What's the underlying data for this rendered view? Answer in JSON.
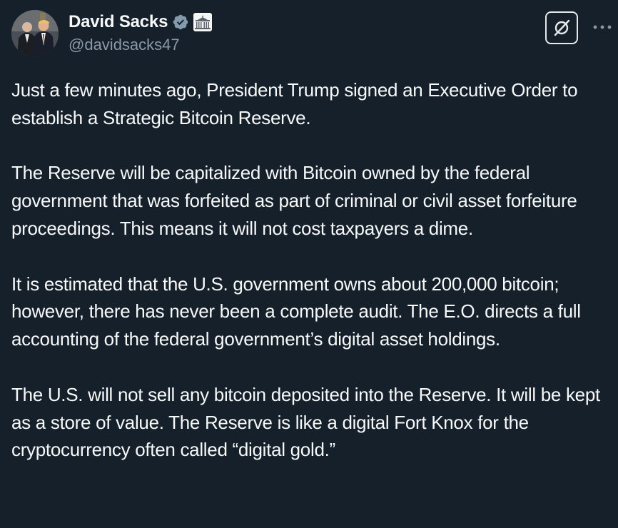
{
  "author": {
    "display_name": "David Sacks",
    "handle": "@davidsacks47",
    "verified_icon": "verified-badge-icon",
    "affiliation_icon": "white-house-icon"
  },
  "actions": {
    "grok_icon": "grok-icon",
    "more_icon": "more-options-icon"
  },
  "tweet": {
    "paragraphs": [
      "Just a few minutes ago, President Trump signed an Executive Order to establish a Strategic Bitcoin Reserve.",
      "The Reserve will be capitalized with Bitcoin owned by the federal government that was forfeited as part of criminal or civil asset forfeiture proceedings. This means it will not cost taxpayers a dime.",
      "It is estimated that the U.S. government owns about 200,000 bitcoin; however, there has never been a complete audit. The E.O. directs a full accounting of the federal government’s digital asset holdings.",
      "The U.S. will not sell any bitcoin deposited into the Reserve. It will be kept as a store of value. The Reserve is like a digital Fort Knox for the cryptocurrency often called “digital gold.”"
    ]
  },
  "colors": {
    "background": "#15202b",
    "text": "#f7f9f9",
    "secondary_text": "#8b98a5",
    "verified": "#829aab"
  }
}
